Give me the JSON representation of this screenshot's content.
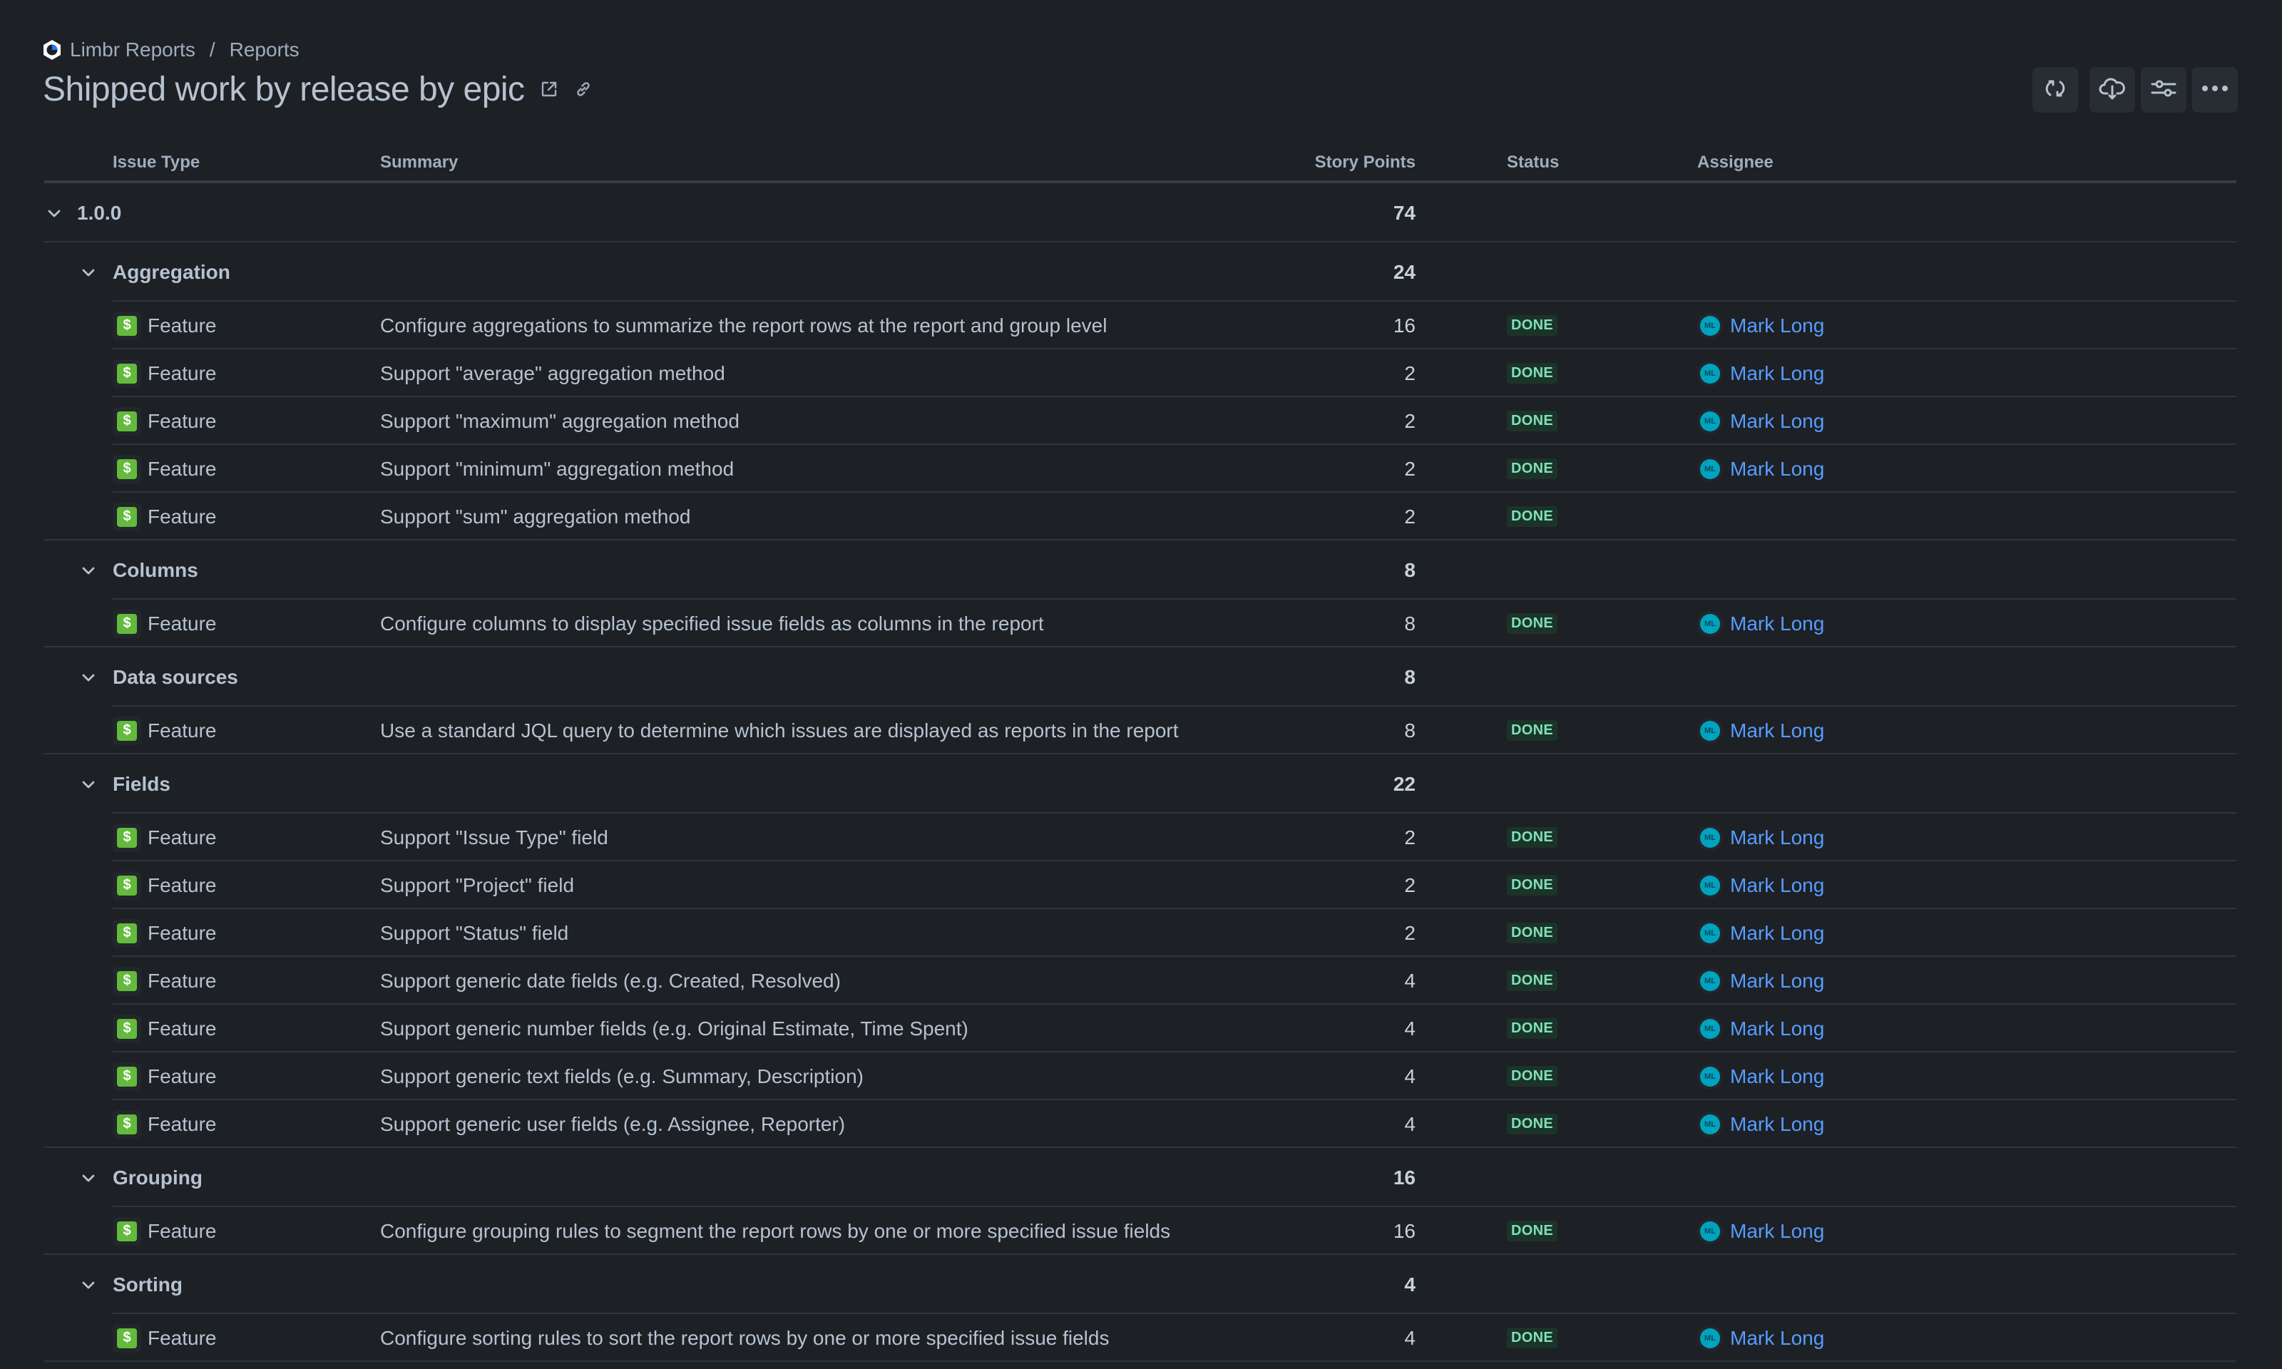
{
  "breadcrumb": {
    "app": "Limbr Reports",
    "separator": "/",
    "section": "Reports"
  },
  "header": {
    "title": "Shipped work by release by epic",
    "icons": [
      "open-in-new-icon",
      "link-icon"
    ]
  },
  "toolbar": {
    "buttons": [
      {
        "name": "refresh",
        "icon": "refresh-icon"
      },
      {
        "name": "export",
        "icon": "cloud-download-icon"
      },
      {
        "name": "configure",
        "icon": "sliders-icon"
      },
      {
        "name": "more",
        "icon": "more-horizontal-icon"
      }
    ]
  },
  "columns": {
    "issue_type": "Issue Type",
    "summary": "Summary",
    "story_points": "Story Points",
    "status": "Status",
    "assignee": "Assignee"
  },
  "colors": {
    "background": "#1d2025",
    "feature_icon": "#63ba3c",
    "status_done_bg": "#1c3329",
    "status_done_text": "#7ee2b8",
    "link": "#579dff",
    "avatar": "#00a3bf"
  },
  "release": {
    "label": "1.0.0",
    "points": "74",
    "epics": [
      {
        "label": "Aggregation",
        "points": "24",
        "issues": [
          {
            "type": "Feature",
            "summary": "Configure aggregations to summarize the report rows at the report and group level",
            "points": "16",
            "status": "DONE",
            "assignee": "Mark Long",
            "initials": "ML"
          },
          {
            "type": "Feature",
            "summary": "Support \"average\" aggregation method",
            "points": "2",
            "status": "DONE",
            "assignee": "Mark Long",
            "initials": "ML"
          },
          {
            "type": "Feature",
            "summary": "Support \"maximum\" aggregation method",
            "points": "2",
            "status": "DONE",
            "assignee": "Mark Long",
            "initials": "ML"
          },
          {
            "type": "Feature",
            "summary": "Support \"minimum\" aggregation method",
            "points": "2",
            "status": "DONE",
            "assignee": "Mark Long",
            "initials": "ML"
          },
          {
            "type": "Feature",
            "summary": "Support \"sum\" aggregation method",
            "points": "2",
            "status": "DONE",
            "assignee": "",
            "initials": ""
          }
        ]
      },
      {
        "label": "Columns",
        "points": "8",
        "issues": [
          {
            "type": "Feature",
            "summary": "Configure columns to display specified issue fields as columns in the report",
            "points": "8",
            "status": "DONE",
            "assignee": "Mark Long",
            "initials": "ML"
          }
        ]
      },
      {
        "label": "Data sources",
        "points": "8",
        "issues": [
          {
            "type": "Feature",
            "summary": "Use a standard JQL query to determine which issues are displayed as reports in the report",
            "points": "8",
            "status": "DONE",
            "assignee": "Mark Long",
            "initials": "ML"
          }
        ]
      },
      {
        "label": "Fields",
        "points": "22",
        "issues": [
          {
            "type": "Feature",
            "summary": "Support \"Issue Type\" field",
            "points": "2",
            "status": "DONE",
            "assignee": "Mark Long",
            "initials": "ML"
          },
          {
            "type": "Feature",
            "summary": "Support \"Project\" field",
            "points": "2",
            "status": "DONE",
            "assignee": "Mark Long",
            "initials": "ML"
          },
          {
            "type": "Feature",
            "summary": "Support \"Status\" field",
            "points": "2",
            "status": "DONE",
            "assignee": "Mark Long",
            "initials": "ML"
          },
          {
            "type": "Feature",
            "summary": "Support generic date fields (e.g. Created, Resolved)",
            "points": "4",
            "status": "DONE",
            "assignee": "Mark Long",
            "initials": "ML"
          },
          {
            "type": "Feature",
            "summary": "Support generic number fields (e.g. Original Estimate, Time Spent)",
            "points": "4",
            "status": "DONE",
            "assignee": "Mark Long",
            "initials": "ML"
          },
          {
            "type": "Feature",
            "summary": "Support generic text fields (e.g. Summary, Description)",
            "points": "4",
            "status": "DONE",
            "assignee": "Mark Long",
            "initials": "ML"
          },
          {
            "type": "Feature",
            "summary": "Support generic user fields (e.g. Assignee, Reporter)",
            "points": "4",
            "status": "DONE",
            "assignee": "Mark Long",
            "initials": "ML"
          }
        ]
      },
      {
        "label": "Grouping",
        "points": "16",
        "issues": [
          {
            "type": "Feature",
            "summary": "Configure grouping rules to segment the report rows by one or more specified issue fields",
            "points": "16",
            "status": "DONE",
            "assignee": "Mark Long",
            "initials": "ML"
          }
        ]
      },
      {
        "label": "Sorting",
        "points": "4",
        "issues": [
          {
            "type": "Feature",
            "summary": "Configure sorting rules to sort the report rows by one or more specified issue fields",
            "points": "4",
            "status": "DONE",
            "assignee": "Mark Long",
            "initials": "ML"
          }
        ]
      }
    ]
  }
}
